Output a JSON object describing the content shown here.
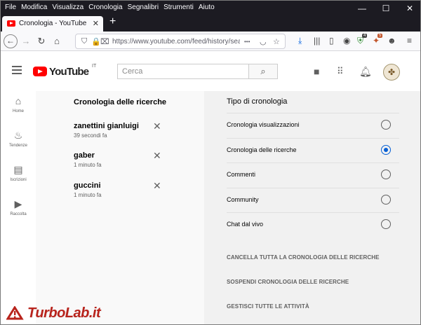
{
  "menubar": {
    "items": [
      "File",
      "Modifica",
      "Visualizza",
      "Cronologia",
      "Segnalibri",
      "Strumenti",
      "Aiuto"
    ]
  },
  "window_controls": {
    "minimize": "—",
    "maximize": "☐",
    "close": "✕"
  },
  "tab": {
    "title": "Cronologia - YouTube",
    "close": "✕",
    "new_tab": "+"
  },
  "browser": {
    "url": "https://www.youtube.com/feed/history/search",
    "more": "•••",
    "extension_badges": [
      "4",
      "5"
    ]
  },
  "youtube": {
    "logo_text": "YouTube",
    "region": "IT",
    "search_placeholder": "Cerca"
  },
  "guide": [
    {
      "icon": "home-icon",
      "label": "Home"
    },
    {
      "icon": "trending-icon",
      "label": "Tendenze"
    },
    {
      "icon": "subscriptions-icon",
      "label": "Iscrizioni"
    },
    {
      "icon": "library-icon",
      "label": "Raccolta"
    }
  ],
  "history": {
    "title": "Cronologia delle ricerche",
    "items": [
      {
        "query": "zanettini gianluigi",
        "time": "39 secondi fa"
      },
      {
        "query": "gaber",
        "time": "1 minuto fa"
      },
      {
        "query": "guccini",
        "time": "1 minuto fa"
      }
    ]
  },
  "history_type": {
    "title": "Tipo di cronologia",
    "options": [
      {
        "label": "Cronologia visualizzazioni",
        "selected": false
      },
      {
        "label": "Cronologia delle ricerche",
        "selected": true
      },
      {
        "label": "Commenti",
        "selected": false
      },
      {
        "label": "Community",
        "selected": false
      },
      {
        "label": "Chat dal vivo",
        "selected": false
      }
    ],
    "actions": [
      "CANCELLA TUTTA LA CRONOLOGIA DELLE RICERCHE",
      "SOSPENDI CRONOLOGIA DELLE RICERCHE",
      "GESTISCI TUTTE LE ATTIVITÀ"
    ]
  },
  "watermark": {
    "text": "TurboLab.it"
  },
  "colors": {
    "accent": "#065fd4",
    "youtube_red": "#ff0000",
    "watermark_red": "#b8231c",
    "chrome_dark": "#1c1b22"
  }
}
